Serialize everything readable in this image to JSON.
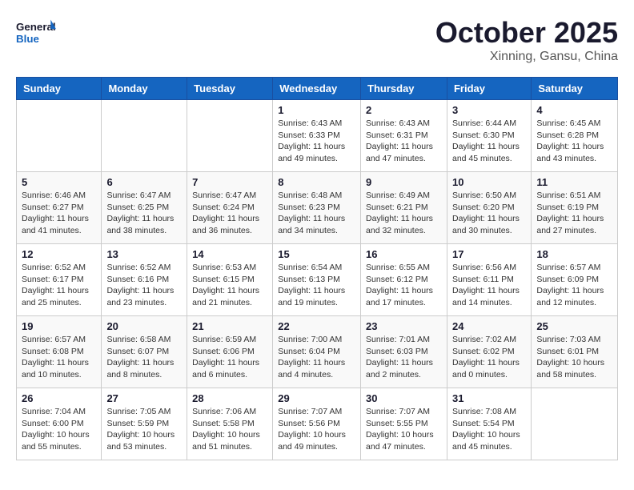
{
  "header": {
    "logo_general": "General",
    "logo_blue": "Blue",
    "month": "October 2025",
    "location": "Xinning, Gansu, China"
  },
  "weekdays": [
    "Sunday",
    "Monday",
    "Tuesday",
    "Wednesday",
    "Thursday",
    "Friday",
    "Saturday"
  ],
  "weeks": [
    [
      {
        "day": "",
        "info": ""
      },
      {
        "day": "",
        "info": ""
      },
      {
        "day": "",
        "info": ""
      },
      {
        "day": "1",
        "info": "Sunrise: 6:43 AM\nSunset: 6:33 PM\nDaylight: 11 hours and 49 minutes."
      },
      {
        "day": "2",
        "info": "Sunrise: 6:43 AM\nSunset: 6:31 PM\nDaylight: 11 hours and 47 minutes."
      },
      {
        "day": "3",
        "info": "Sunrise: 6:44 AM\nSunset: 6:30 PM\nDaylight: 11 hours and 45 minutes."
      },
      {
        "day": "4",
        "info": "Sunrise: 6:45 AM\nSunset: 6:28 PM\nDaylight: 11 hours and 43 minutes."
      }
    ],
    [
      {
        "day": "5",
        "info": "Sunrise: 6:46 AM\nSunset: 6:27 PM\nDaylight: 11 hours and 41 minutes."
      },
      {
        "day": "6",
        "info": "Sunrise: 6:47 AM\nSunset: 6:25 PM\nDaylight: 11 hours and 38 minutes."
      },
      {
        "day": "7",
        "info": "Sunrise: 6:47 AM\nSunset: 6:24 PM\nDaylight: 11 hours and 36 minutes."
      },
      {
        "day": "8",
        "info": "Sunrise: 6:48 AM\nSunset: 6:23 PM\nDaylight: 11 hours and 34 minutes."
      },
      {
        "day": "9",
        "info": "Sunrise: 6:49 AM\nSunset: 6:21 PM\nDaylight: 11 hours and 32 minutes."
      },
      {
        "day": "10",
        "info": "Sunrise: 6:50 AM\nSunset: 6:20 PM\nDaylight: 11 hours and 30 minutes."
      },
      {
        "day": "11",
        "info": "Sunrise: 6:51 AM\nSunset: 6:19 PM\nDaylight: 11 hours and 27 minutes."
      }
    ],
    [
      {
        "day": "12",
        "info": "Sunrise: 6:52 AM\nSunset: 6:17 PM\nDaylight: 11 hours and 25 minutes."
      },
      {
        "day": "13",
        "info": "Sunrise: 6:52 AM\nSunset: 6:16 PM\nDaylight: 11 hours and 23 minutes."
      },
      {
        "day": "14",
        "info": "Sunrise: 6:53 AM\nSunset: 6:15 PM\nDaylight: 11 hours and 21 minutes."
      },
      {
        "day": "15",
        "info": "Sunrise: 6:54 AM\nSunset: 6:13 PM\nDaylight: 11 hours and 19 minutes."
      },
      {
        "day": "16",
        "info": "Sunrise: 6:55 AM\nSunset: 6:12 PM\nDaylight: 11 hours and 17 minutes."
      },
      {
        "day": "17",
        "info": "Sunrise: 6:56 AM\nSunset: 6:11 PM\nDaylight: 11 hours and 14 minutes."
      },
      {
        "day": "18",
        "info": "Sunrise: 6:57 AM\nSunset: 6:09 PM\nDaylight: 11 hours and 12 minutes."
      }
    ],
    [
      {
        "day": "19",
        "info": "Sunrise: 6:57 AM\nSunset: 6:08 PM\nDaylight: 11 hours and 10 minutes."
      },
      {
        "day": "20",
        "info": "Sunrise: 6:58 AM\nSunset: 6:07 PM\nDaylight: 11 hours and 8 minutes."
      },
      {
        "day": "21",
        "info": "Sunrise: 6:59 AM\nSunset: 6:06 PM\nDaylight: 11 hours and 6 minutes."
      },
      {
        "day": "22",
        "info": "Sunrise: 7:00 AM\nSunset: 6:04 PM\nDaylight: 11 hours and 4 minutes."
      },
      {
        "day": "23",
        "info": "Sunrise: 7:01 AM\nSunset: 6:03 PM\nDaylight: 11 hours and 2 minutes."
      },
      {
        "day": "24",
        "info": "Sunrise: 7:02 AM\nSunset: 6:02 PM\nDaylight: 11 hours and 0 minutes."
      },
      {
        "day": "25",
        "info": "Sunrise: 7:03 AM\nSunset: 6:01 PM\nDaylight: 10 hours and 58 minutes."
      }
    ],
    [
      {
        "day": "26",
        "info": "Sunrise: 7:04 AM\nSunset: 6:00 PM\nDaylight: 10 hours and 55 minutes."
      },
      {
        "day": "27",
        "info": "Sunrise: 7:05 AM\nSunset: 5:59 PM\nDaylight: 10 hours and 53 minutes."
      },
      {
        "day": "28",
        "info": "Sunrise: 7:06 AM\nSunset: 5:58 PM\nDaylight: 10 hours and 51 minutes."
      },
      {
        "day": "29",
        "info": "Sunrise: 7:07 AM\nSunset: 5:56 PM\nDaylight: 10 hours and 49 minutes."
      },
      {
        "day": "30",
        "info": "Sunrise: 7:07 AM\nSunset: 5:55 PM\nDaylight: 10 hours and 47 minutes."
      },
      {
        "day": "31",
        "info": "Sunrise: 7:08 AM\nSunset: 5:54 PM\nDaylight: 10 hours and 45 minutes."
      },
      {
        "day": "",
        "info": ""
      }
    ]
  ]
}
